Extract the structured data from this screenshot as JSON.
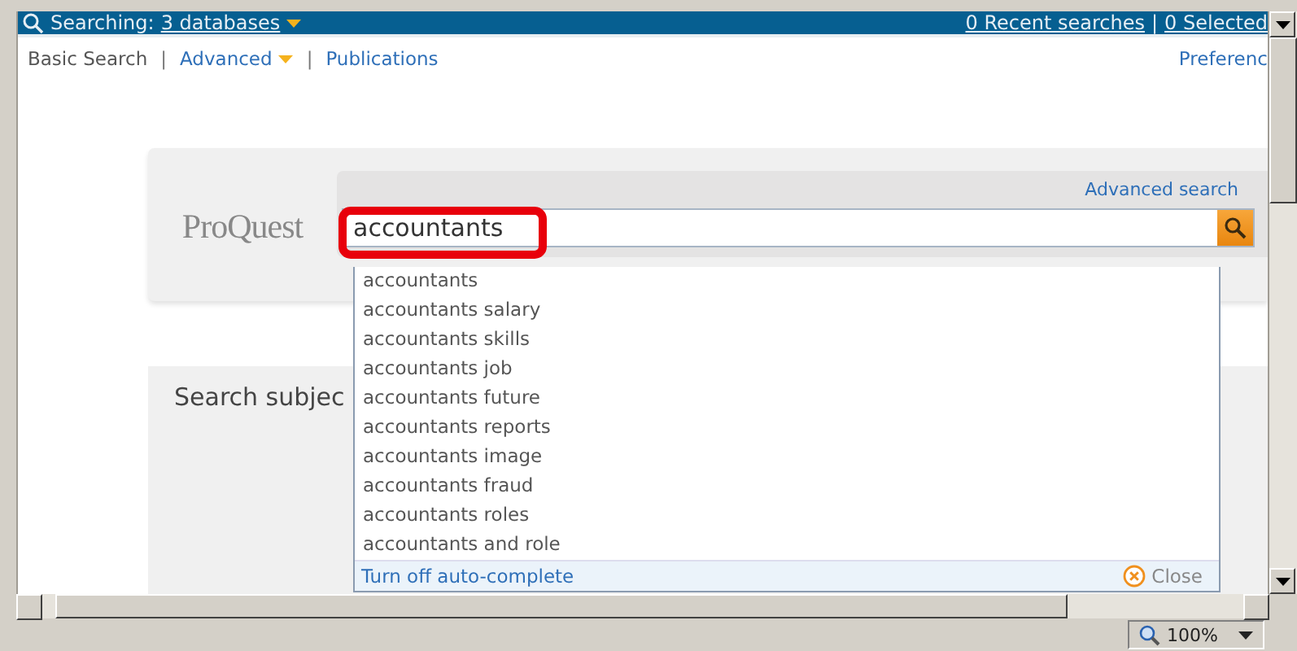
{
  "top_bar": {
    "searching_label": "Searching:",
    "databases_link": "3 databases",
    "recent_searches": "0 Recent searches",
    "separator": "|",
    "selected_items": "0 Selected"
  },
  "nav": [
    {
      "label": "Basic Search",
      "selected": true,
      "dropdown": false
    },
    {
      "label": "Advanced",
      "selected": false,
      "dropdown": true
    },
    {
      "label": "Publications",
      "selected": false,
      "dropdown": false
    }
  ],
  "nav_separator": "|",
  "preferences_link": "Preferenc",
  "search_panel": {
    "logo": "ProQuest",
    "advanced_search_link": "Advanced search",
    "query": "accountants",
    "highlighted": true
  },
  "autocomplete": {
    "suggestions": [
      "accountants",
      "accountants salary",
      "accountants skills",
      "accountants job",
      "accountants future",
      "accountants reports",
      "accountants image",
      "accountants fraud",
      "accountants roles",
      "accountants and role"
    ],
    "turn_off": "Turn off auto-complete",
    "close": "Close"
  },
  "subjects_panel": {
    "title": "Search subjec"
  },
  "status_bar": {
    "zoom": "100%"
  }
}
